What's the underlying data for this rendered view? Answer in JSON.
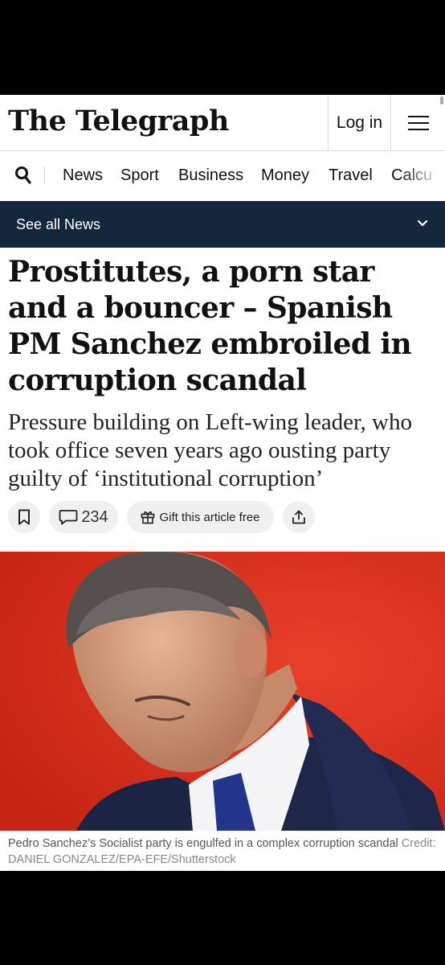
{
  "masthead": {
    "logo": "The Telegraph",
    "login_label": "Log in",
    "menu_icon": "hamburger-icon"
  },
  "nav": {
    "search_icon": "search-icon",
    "items": [
      "News",
      "Sport",
      "Business",
      "Money",
      "Travel",
      "Calcu"
    ]
  },
  "section_bar": {
    "label": "See all News",
    "icon": "chevron-down-icon",
    "background": "#14283c"
  },
  "article": {
    "headline": "Prostitutes, a porn star and a bouncer – Spanish PM Sanchez embroiled in corruption scandal",
    "standfirst": "Pressure building on Left-wing leader, who took office seven years ago ousting party guilty of ‘institutional corruption’",
    "actions": {
      "bookmark_icon": "bookmark-icon",
      "comments_icon": "comment-icon",
      "comment_count": "234",
      "gift_icon": "gift-icon",
      "gift_label": "Gift this article free",
      "share_icon": "share-icon"
    },
    "image": {
      "background": "#e0321e"
    },
    "caption": "Pedro Sanchez’s Socialist party is engulfed in a complex corruption scandal",
    "credit": "Credit: DANIEL GONZALEZ/EPA-EFE/Shutterstock"
  }
}
